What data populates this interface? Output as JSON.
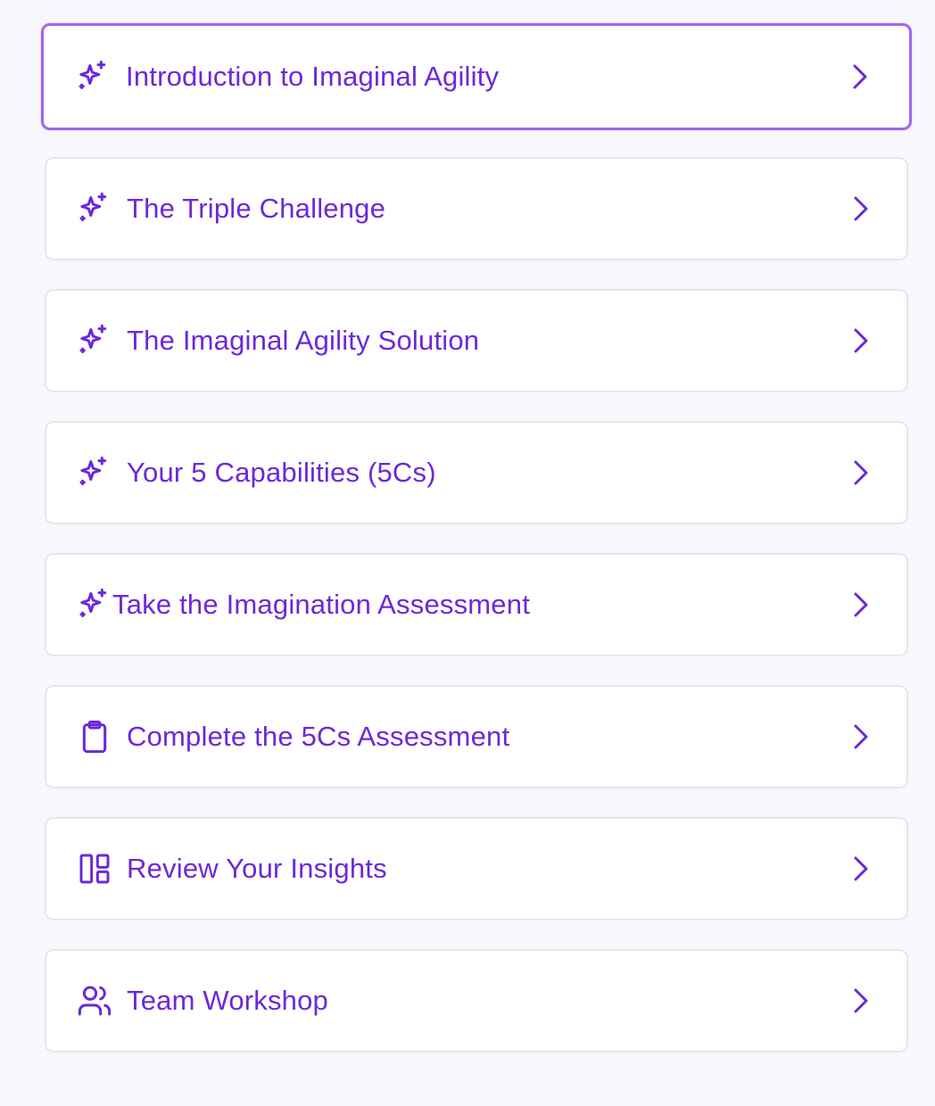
{
  "accent_color": "#6d28d9",
  "active_border_color": "#9f67f0",
  "steps": [
    {
      "label": "Introduction to Imaginal Agility",
      "icon": "sparkles-icon",
      "active": true
    },
    {
      "label": "The Triple Challenge",
      "icon": "sparkles-icon",
      "active": false
    },
    {
      "label": "The Imaginal Agility Solution",
      "icon": "sparkles-icon",
      "active": false
    },
    {
      "label": "Your 5 Capabilities (5Cs)",
      "icon": "sparkles-icon",
      "active": false
    },
    {
      "label": "Take the Imagination Assessment",
      "icon": "sparkles-icon",
      "active": false
    },
    {
      "label": "Complete the 5Cs Assessment",
      "icon": "clipboard-icon",
      "active": false
    },
    {
      "label": "Review Your Insights",
      "icon": "layout-dashboard-icon",
      "active": false
    },
    {
      "label": "Team Workshop",
      "icon": "users-icon",
      "active": false
    }
  ]
}
